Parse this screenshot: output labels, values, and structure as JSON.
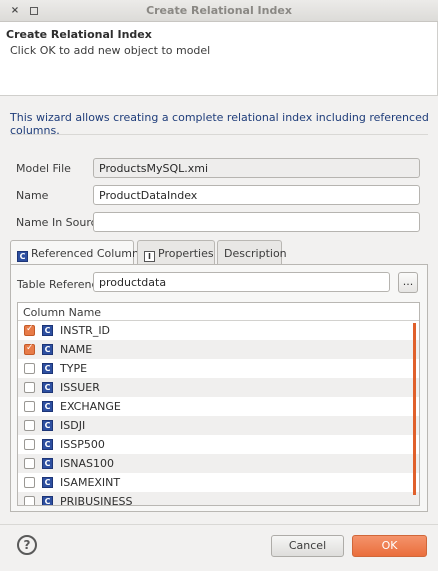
{
  "window": {
    "title": "Create Relational Index",
    "close_glyph": "×"
  },
  "header": {
    "title": "Create Relational Index",
    "message": "Click OK to add new object to model"
  },
  "description": "This wizard allows creating a complete relational index including referenced columns.",
  "form": {
    "model_file_label": "Model File",
    "model_file_value": "ProductsMySQL.xmi",
    "name_label": "Name",
    "name_value": "ProductDataIndex",
    "name_in_source_label": "Name In Source",
    "name_in_source_value": ""
  },
  "tabs": [
    {
      "label": "Referenced Columns",
      "icon": "column-icon",
      "active": true
    },
    {
      "label": "Properties",
      "icon": "properties-icon",
      "active": false
    },
    {
      "label": "Description",
      "active": false
    }
  ],
  "icons": {
    "column_glyph": "C",
    "properties_glyph": "I"
  },
  "referenced_columns": {
    "table_reference_label": "Table Reference",
    "table_reference_value": "productdata",
    "browse_label": "...",
    "column_header": "Column Name",
    "rows": [
      {
        "name": "INSTR_ID",
        "checked": true
      },
      {
        "name": "NAME",
        "checked": true
      },
      {
        "name": "TYPE",
        "checked": false
      },
      {
        "name": "ISSUER",
        "checked": false
      },
      {
        "name": "EXCHANGE",
        "checked": false
      },
      {
        "name": "ISDJI",
        "checked": false
      },
      {
        "name": "ISSP500",
        "checked": false
      },
      {
        "name": "ISNAS100",
        "checked": false
      },
      {
        "name": "ISAMEXINT",
        "checked": false
      },
      {
        "name": "PRIBUSINESS",
        "checked": false
      }
    ]
  },
  "footer": {
    "help_glyph": "?",
    "cancel_label": "Cancel",
    "ok_label": "OK"
  },
  "colors": {
    "accent": "#e77b48",
    "ok_button": "#ea6e3c",
    "description_text": "#1f3d7a",
    "column_icon": "#2d4fa0"
  }
}
